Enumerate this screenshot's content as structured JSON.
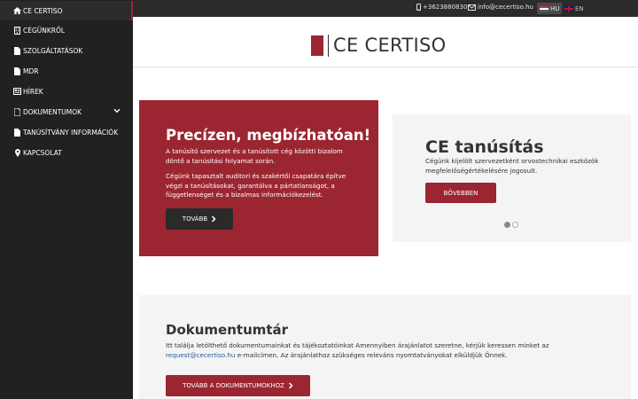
{
  "sidebar": {
    "items": [
      {
        "label": "CE CERTISO",
        "icon": "home-icon",
        "active": true
      },
      {
        "label": "CÉGÜNKRŐL",
        "icon": "building-icon"
      },
      {
        "label": "SZOLGÁLTATÁSOK",
        "icon": "document-icon"
      },
      {
        "label": "MDR",
        "icon": "document-icon"
      },
      {
        "label": "HÍREK",
        "icon": "newspaper-icon"
      },
      {
        "label": "DOKUMENTUMOK",
        "icon": "document-icon",
        "has_submenu": true
      },
      {
        "label": "TANÚSÍTVÁNY INFORMÁCIÓK",
        "icon": "document-icon"
      },
      {
        "label": "KAPCSOLAT",
        "icon": "map-marker-icon"
      }
    ]
  },
  "topbar": {
    "phone": "+3623880830",
    "email": "info@cecertiso.hu",
    "languages": [
      {
        "code": "HU",
        "active": true
      },
      {
        "code": "EN",
        "active": false
      }
    ]
  },
  "header": {
    "brand": "CE CERTISO"
  },
  "hero": {
    "title": "Precízen, megbízhatóan!",
    "paragraph1": "A tanúsító szervezet és a tanúsított cég közötti bizalom döntő a tanúsítási folyamat során.",
    "paragraph2": "Cégünk tapasztalt auditori és szakértői csapatára építve végzi a tanúsításokat, garantálva a pártatlanságot, a függetlenséget és a bizalmas információkezelést.",
    "button_label": "TOVÁBB"
  },
  "carousel": {
    "title": "CE tanúsítás",
    "text": "Cégünk kijelölt szervezetként orvostechnikai eszközök megfelelőségértékelésére jogosult.",
    "button_label": "BŐVEBBEN",
    "slide_count": 2,
    "active_slide": 1
  },
  "documents": {
    "title": "Dokumentumtár",
    "text_before": "Itt találja letölthető dokumentumainkat és tájékoztatóinkat Amennyiben árajánlatot szeretne, kérjük keressen minket az",
    "email": "request@cecertiso.hu",
    "text_after": "e-mailcímen. Az árajánlathoz szükséges releváns nyomtatványokat elküldjük Önnek.",
    "button_label": "TOVÁBB A DOKUMENTUMOKHOZ"
  },
  "colors": {
    "accent": "#9b2631",
    "sidebar_bg": "#212121",
    "topbar_bg": "#2b2b2b",
    "card_grey": "#f4f4f4"
  }
}
